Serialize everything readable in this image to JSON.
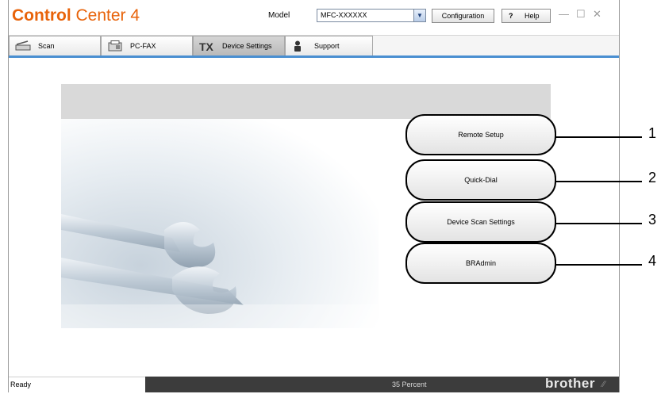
{
  "app": {
    "title_bold": "Control",
    "title_light": "Center 4"
  },
  "toolbar": {
    "model_label": "Model",
    "model_value": "MFC-XXXXXX",
    "configuration_label": "Configuration",
    "help_glyph": "?",
    "help_label": "Help",
    "minimize_glyph": "—",
    "maximize_glyph": "☐",
    "close_glyph": "✕"
  },
  "tabs": [
    {
      "label": "Scan",
      "icon": "scanner-icon"
    },
    {
      "label": "PC-FAX",
      "icon": "fax-icon"
    },
    {
      "label": "Device Settings",
      "icon": "tools-icon",
      "active": true
    },
    {
      "label": "Support",
      "icon": "person-icon"
    }
  ],
  "actions": [
    {
      "label": "Remote Setup",
      "callout": "1"
    },
    {
      "label": "Quick-Dial",
      "callout": "2"
    },
    {
      "label": "Device Scan Settings",
      "callout": "3"
    },
    {
      "label": "BRAdmin",
      "callout": "4"
    }
  ],
  "status": {
    "ready": "Ready",
    "percent": "35 Percent",
    "brand": "brother"
  },
  "colors": {
    "brand_orange": "#e8630a",
    "tab_accent": "#4a8fd1",
    "status_bar": "#3c3c3c"
  }
}
